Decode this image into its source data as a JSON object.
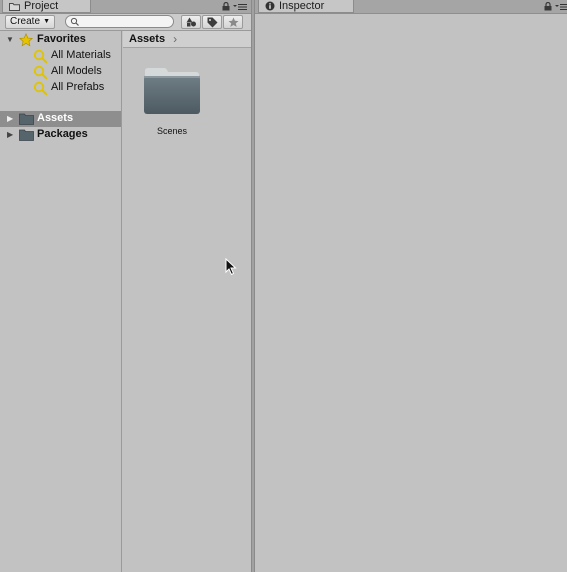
{
  "tabs": {
    "project": {
      "label": "Project"
    },
    "inspector": {
      "label": "Inspector"
    }
  },
  "toolbar": {
    "create_label": "Create",
    "search_value": ""
  },
  "tree": {
    "favorites": {
      "label": "Favorites",
      "items": [
        {
          "label": "All Materials"
        },
        {
          "label": "All Models"
        },
        {
          "label": "All Prefabs"
        }
      ]
    },
    "roots": [
      {
        "label": "Assets",
        "selected": true
      },
      {
        "label": "Packages",
        "selected": false
      }
    ]
  },
  "content": {
    "breadcrumb": "Assets",
    "items": [
      {
        "label": "Scenes",
        "type": "folder"
      }
    ]
  },
  "colors": {
    "panel_bg": "#c2c2c2",
    "selection_bg": "#8e8e8e",
    "folder": "#5d6b73",
    "favorite_star": "#e0c000"
  }
}
